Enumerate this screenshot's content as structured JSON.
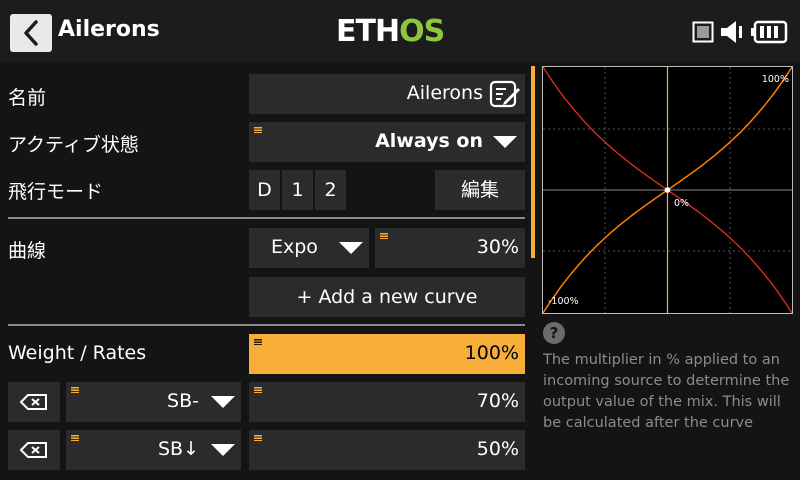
{
  "header": {
    "title": "Ailerons",
    "logo_main": "ETH",
    "logo_accent": "OS"
  },
  "form": {
    "name_label": "名前",
    "name_value": "Ailerons",
    "active_label": "アクティブ状態",
    "active_value": "Always on",
    "flight_mode_label": "飛行モード",
    "flight_modes": [
      "D",
      "1",
      "2"
    ],
    "edit_button": "編集",
    "curve_label": "曲線",
    "curve_type": "Expo",
    "curve_value": "30%",
    "add_curve_button": "+ Add a new curve",
    "weight_label": "Weight / Rates",
    "weight_value": "100%",
    "rates": [
      {
        "source": "SB-",
        "value": "70%"
      },
      {
        "source": "SB↓",
        "value": "50%"
      }
    ]
  },
  "graph": {
    "top_right_label": "100%",
    "center_label": "0%",
    "bottom_left_label": "-100%",
    "curve_color": "#ff7f00",
    "mirror_curve_color": "#e0301e",
    "axis_color": "#f7ae38"
  },
  "help": {
    "icon": "?",
    "text": "The multiplier in % applied to an incoming source to determine the output value of the mix. This will be calculated after the curve"
  },
  "colors": {
    "accent": "#f7ae38",
    "background": "#141414",
    "field": "#2b2b2b",
    "logo_green": "#8dc63f"
  }
}
